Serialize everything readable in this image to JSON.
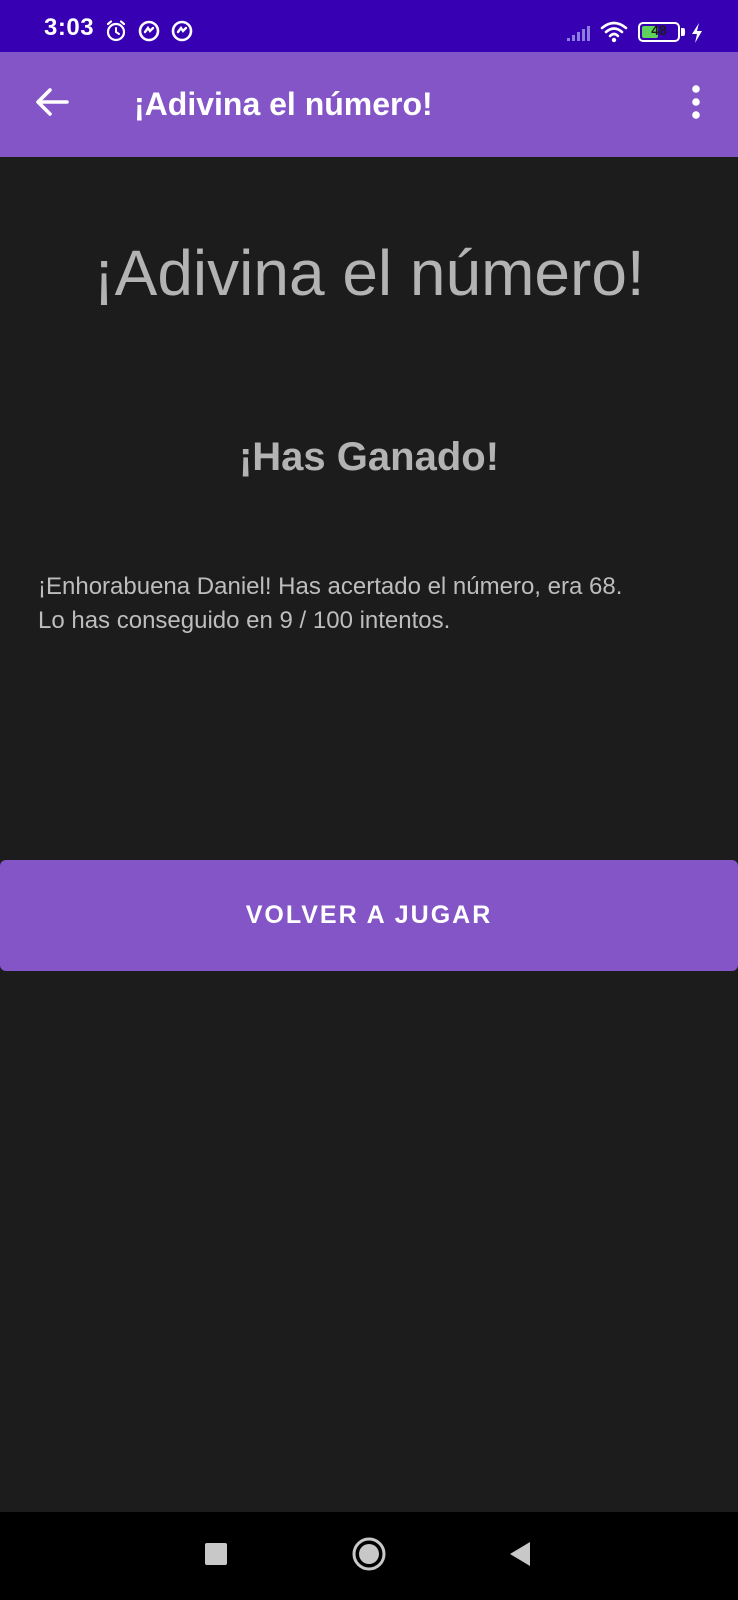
{
  "status_bar": {
    "time": "3:03",
    "battery_level": "48",
    "battery_fraction": 0.48,
    "icons": [
      "alarm-icon",
      "sync-icon",
      "sync-icon",
      "signal-icon",
      "wifi-icon",
      "battery-icon",
      "charging-icon"
    ]
  },
  "app_bar": {
    "title": "¡Adivina el número!",
    "back_icon": "arrow-back-icon",
    "menu_icon": "more-vert-icon"
  },
  "main": {
    "headline": "¡Adivina el número!",
    "result_title": "¡Has Ganado!",
    "message_line1": "¡Enhorabuena Daniel! Has acertado el número, era 68.",
    "message_line2": "Lo has conseguido en 9 / 100 intentos.",
    "play_again_label": "VOLVER A JUGAR"
  },
  "nav_bar": {
    "buttons": [
      "recents-square-icon",
      "home-circle-icon",
      "back-triangle-icon"
    ]
  },
  "colors": {
    "status_bar": "#3700b3",
    "primary": "#8455c6",
    "background": "#1c1c1c",
    "text": "#b3b3b3"
  }
}
